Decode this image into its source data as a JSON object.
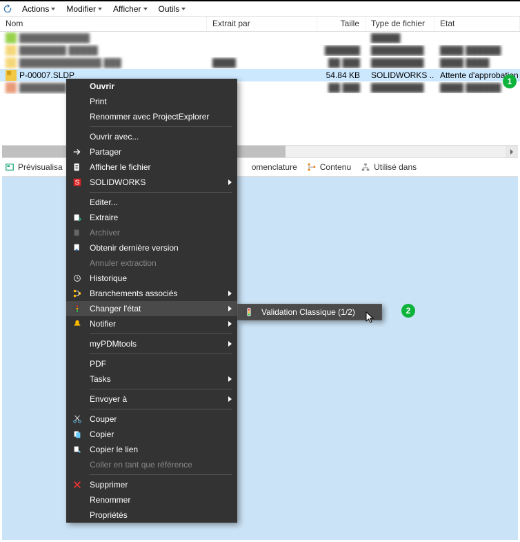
{
  "menubar": {
    "items": [
      "Actions",
      "Modifier",
      "Afficher",
      "Outils"
    ]
  },
  "grid": {
    "headers": {
      "name": "Nom",
      "extrait": "Extrait par",
      "taille": "Taille",
      "type": "Type de fichier",
      "etat": "Etat"
    },
    "rows": [
      {
        "name": "",
        "extrait": "",
        "taille": "",
        "type": "",
        "etat": ""
      },
      {
        "name": "",
        "extrait": "",
        "taille": "",
        "type": "",
        "etat": ""
      },
      {
        "name": "",
        "extrait": "",
        "taille": "",
        "type": "",
        "etat": ""
      },
      {
        "name": "P-00007.SLDP",
        "extrait": "",
        "taille": "54.84 KB",
        "type": "SOLIDWORKS ...",
        "etat": "Attente d'approbation"
      },
      {
        "name": "",
        "extrait": "",
        "taille": "",
        "type": "",
        "etat": ""
      }
    ]
  },
  "tabs": {
    "previsualisation": "Prévisualisa",
    "nomenclature": "omenclature",
    "contenu": "Contenu",
    "utilise": "Utilisé dans"
  },
  "badges": {
    "one": "1",
    "two": "2"
  },
  "context_menu": {
    "ouvrir": "Ouvrir",
    "print": "Print",
    "renommer_pe": "Renommer avec ProjectExplorer",
    "ouvrir_avec": "Ouvrir avec...",
    "partager": "Partager",
    "afficher_fichier": "Afficher le fichier",
    "solidworks": "SOLIDWORKS",
    "editer": "Editer...",
    "extraire": "Extraire",
    "archiver": "Archiver",
    "obtenir": "Obtenir dernière version",
    "annuler": "Annuler extraction",
    "historique": "Historique",
    "branchements": "Branchements associés",
    "changer_etat": "Changer l'état",
    "notifier": "Notifier",
    "mypdmtools": "myPDMtools",
    "pdf": "PDF",
    "tasks": "Tasks",
    "envoyer": "Envoyer à",
    "couper": "Couper",
    "copier": "Copier",
    "copier_lien": "Copier le lien",
    "coller_ref": "Coller en tant que référence",
    "supprimer": "Supprimer",
    "renommer": "Renommer",
    "proprietes": "Propriétés"
  },
  "submenu": {
    "validation": "Validation Classique (1/2)"
  }
}
